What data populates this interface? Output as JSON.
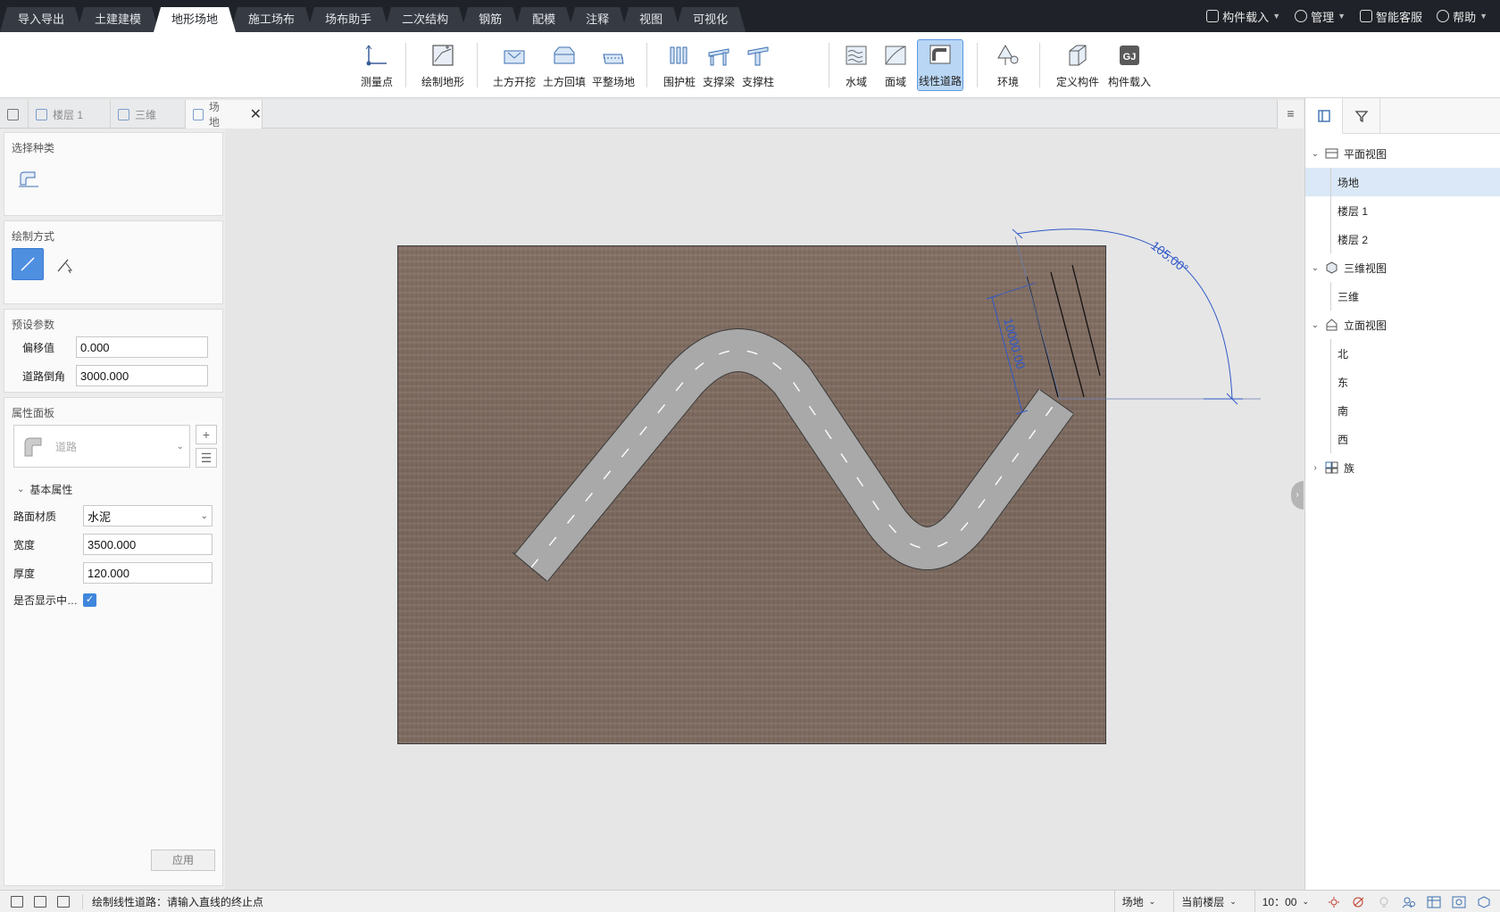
{
  "menu_tabs": [
    "导入导出",
    "土建建模",
    "地形场地",
    "施工场布",
    "场布助手",
    "二次结构",
    "钢筋",
    "配模",
    "注释",
    "视图",
    "可视化"
  ],
  "active_menu_tab": "地形场地",
  "top_right": {
    "load_component": "构件载入",
    "manage": "管理",
    "smart_service": "智能客服",
    "help": "帮助"
  },
  "ribbon": {
    "measure_point": "测量点",
    "draw_terrain": "绘制地形",
    "excavation": "土方开挖",
    "backfill": "土方回填",
    "level_site": "平整场地",
    "retaining_pile": "围护桩",
    "support_beam": "支撑梁",
    "support_column": "支撑柱",
    "water_area": "水域",
    "surface_area": "面域",
    "linear_road": "线性道路",
    "environment": "环境",
    "define_component": "定义构件",
    "component_load": "构件载入"
  },
  "doc_tabs": [
    "楼层 1",
    "三维",
    "场地"
  ],
  "menu_glyph": "≡",
  "left_panel": {
    "select_type_title": "选择种类",
    "draw_mode_title": "绘制方式",
    "preset_title": "预设参数",
    "offset_label": "偏移值",
    "offset_value": "0.000",
    "road_chamfer_label": "道路倒角",
    "road_chamfer_value": "3000.000",
    "property_title": "属性面板",
    "type_name": "道路",
    "basic_props": "基本属性",
    "material_label": "路面材质",
    "material_value": "水泥",
    "width_label": "宽度",
    "width_value": "3500.000",
    "thickness_label": "厚度",
    "thickness_value": "120.000",
    "show_center_label": "是否显示中…",
    "show_center_checked": true,
    "apply": "应用"
  },
  "canvas": {
    "angle_dim": "105.00°",
    "length_dim": "10000.00",
    "colors": {
      "terrain": "#7c6a60",
      "road": "#a9a9a9",
      "dimension": "#2f58c8"
    }
  },
  "tree": {
    "plan_view": "平面视图",
    "plan_children": [
      "场地",
      "楼层 1",
      "楼层 2"
    ],
    "selected": "场地",
    "view_3d": "三维视图",
    "view_3d_children": [
      "三维"
    ],
    "elevation": "立面视图",
    "elevation_children": [
      "北",
      "东",
      "南",
      "西"
    ],
    "family": "族"
  },
  "status": {
    "message": "绘制线性道路：请输入直线的终止点",
    "site_dd": "场地",
    "floor_dd": "当前楼层",
    "scale_dd": "10：00"
  }
}
